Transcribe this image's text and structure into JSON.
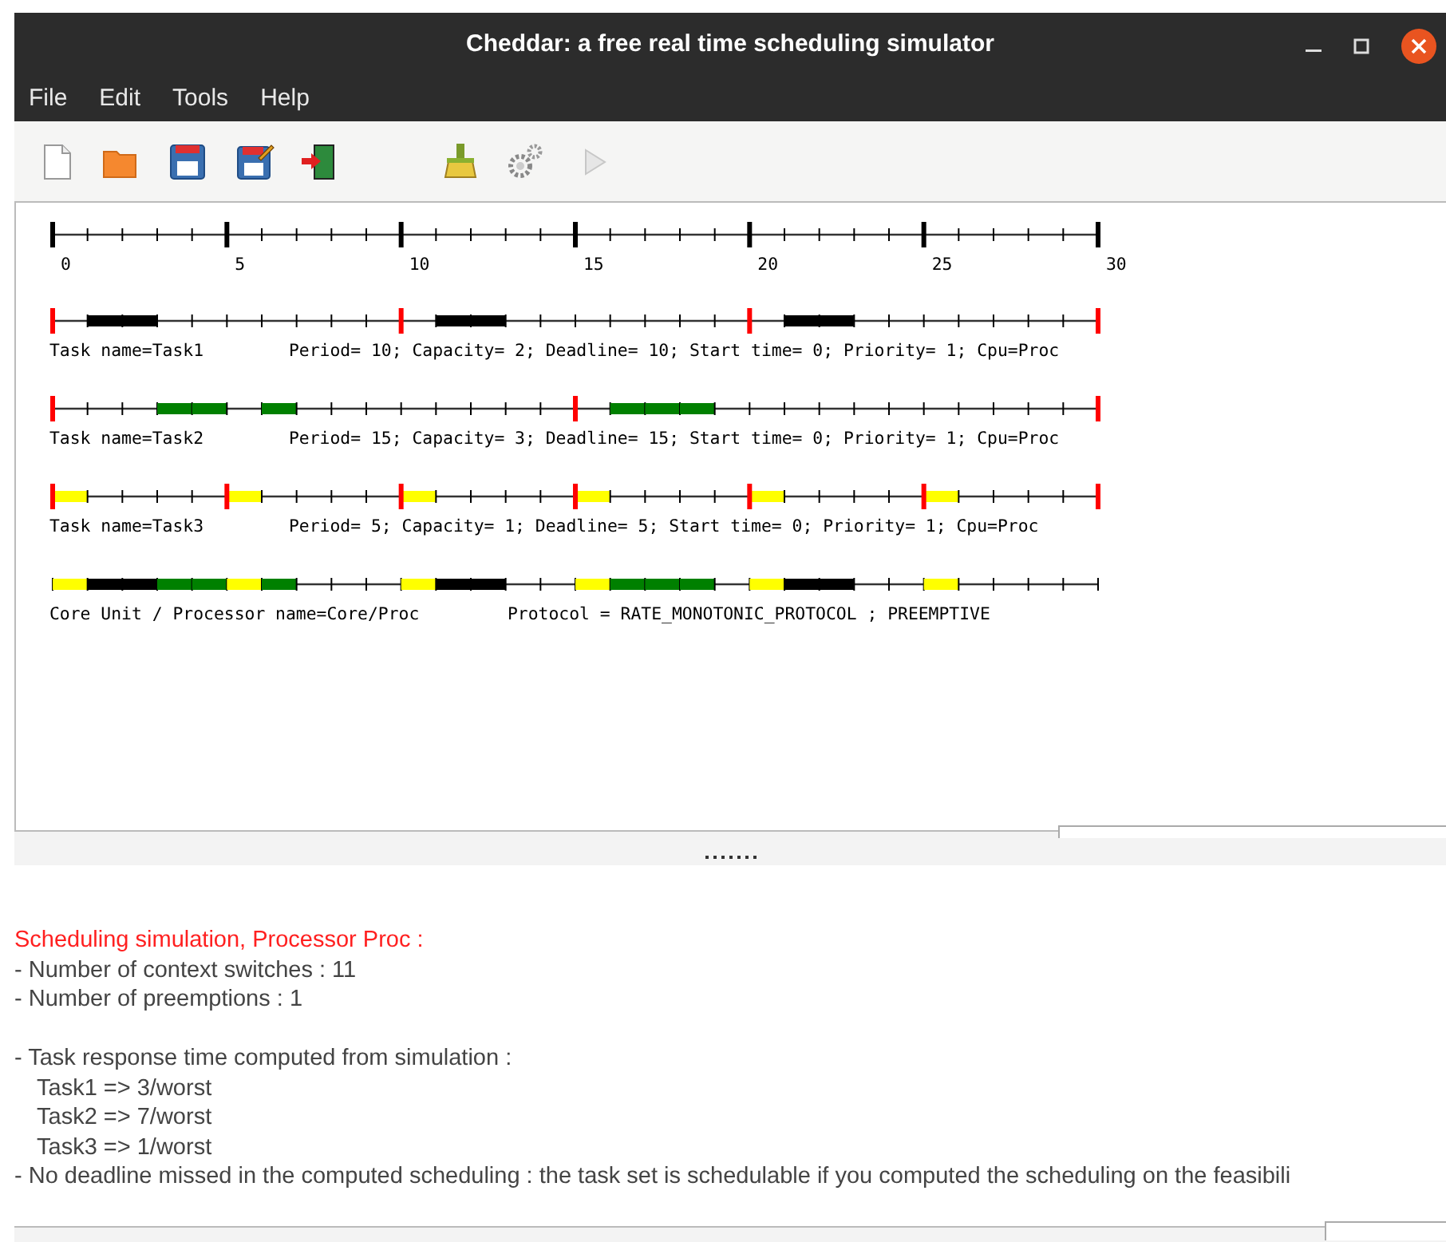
{
  "window": {
    "title": "Cheddar: a free real time scheduling simulator"
  },
  "menu": [
    "File",
    "Edit",
    "Tools",
    "Help"
  ],
  "toolbar": [
    {
      "kind": "new",
      "disabled": false
    },
    {
      "kind": "open",
      "disabled": false
    },
    {
      "kind": "save",
      "disabled": false
    },
    {
      "kind": "save_as",
      "disabled": false
    },
    {
      "kind": "exit",
      "disabled": false
    },
    {
      "kind": "clear",
      "disabled": false
    },
    {
      "kind": "settings",
      "disabled": false
    },
    {
      "kind": "run",
      "disabled": true
    }
  ],
  "time_axis": {
    "ticks": [
      "0",
      "5",
      "10",
      "15",
      "20",
      "25",
      "30"
    ]
  },
  "tasks": [
    {
      "name_label": "Task name=Task1",
      "parameters": "Period= 10; Capacity= 2; Deadline= 10; Start time= 0; Priority= 1; Cpu=Proc",
      "color": "#000000",
      "ticks": [
        {
          "release": true,
          "running": false
        },
        {
          "release": false,
          "running": true
        },
        {
          "release": false,
          "running": true
        },
        {
          "release": false,
          "running": false
        },
        {
          "release": false,
          "running": false
        },
        {
          "release": false,
          "running": false
        },
        {
          "release": false,
          "running": false
        },
        {
          "release": false,
          "running": false
        },
        {
          "release": false,
          "running": false
        },
        {
          "release": false,
          "running": false
        },
        {
          "release": true,
          "running": false
        },
        {
          "release": false,
          "running": true
        },
        {
          "release": false,
          "running": true
        },
        {
          "release": false,
          "running": false
        },
        {
          "release": false,
          "running": false
        },
        {
          "release": false,
          "running": false
        },
        {
          "release": false,
          "running": false
        },
        {
          "release": false,
          "running": false
        },
        {
          "release": false,
          "running": false
        },
        {
          "release": false,
          "running": false
        },
        {
          "release": true,
          "running": false
        },
        {
          "release": false,
          "running": true
        },
        {
          "release": false,
          "running": true
        },
        {
          "release": false,
          "running": false
        },
        {
          "release": false,
          "running": false
        },
        {
          "release": false,
          "running": false
        },
        {
          "release": false,
          "running": false
        },
        {
          "release": false,
          "running": false
        },
        {
          "release": false,
          "running": false
        },
        {
          "release": false,
          "running": false
        },
        {
          "release": true,
          "running": false
        }
      ]
    },
    {
      "name_label": "Task name=Task2",
      "parameters": "Period= 15; Capacity= 3; Deadline= 15; Start time= 0; Priority= 1; Cpu=Proc",
      "color": "#008000",
      "ticks": [
        {
          "release": true,
          "running": false
        },
        {
          "release": false,
          "running": false
        },
        {
          "release": false,
          "running": false
        },
        {
          "release": false,
          "running": true
        },
        {
          "release": false,
          "running": true
        },
        {
          "release": false,
          "running": false
        },
        {
          "release": false,
          "running": true
        },
        {
          "release": false,
          "running": false
        },
        {
          "release": false,
          "running": false
        },
        {
          "release": false,
          "running": false
        },
        {
          "release": false,
          "running": false
        },
        {
          "release": false,
          "running": false
        },
        {
          "release": false,
          "running": false
        },
        {
          "release": false,
          "running": false
        },
        {
          "release": false,
          "running": false
        },
        {
          "release": true,
          "running": false
        },
        {
          "release": false,
          "running": true
        },
        {
          "release": false,
          "running": true
        },
        {
          "release": false,
          "running": true
        },
        {
          "release": false,
          "running": false
        },
        {
          "release": false,
          "running": false
        },
        {
          "release": false,
          "running": false
        },
        {
          "release": false,
          "running": false
        },
        {
          "release": false,
          "running": false
        },
        {
          "release": false,
          "running": false
        },
        {
          "release": false,
          "running": false
        },
        {
          "release": false,
          "running": false
        },
        {
          "release": false,
          "running": false
        },
        {
          "release": false,
          "running": false
        },
        {
          "release": false,
          "running": false
        },
        {
          "release": true,
          "running": false
        }
      ]
    },
    {
      "name_label": "Task name=Task3",
      "parameters": "Period= 5; Capacity= 1; Deadline= 5; Start time= 0; Priority= 1; Cpu=Proc",
      "color": "#ffff00",
      "ticks": [
        {
          "release": true,
          "running": true
        },
        {
          "release": false,
          "running": false
        },
        {
          "release": false,
          "running": false
        },
        {
          "release": false,
          "running": false
        },
        {
          "release": false,
          "running": false
        },
        {
          "release": true,
          "running": true
        },
        {
          "release": false,
          "running": false
        },
        {
          "release": false,
          "running": false
        },
        {
          "release": false,
          "running": false
        },
        {
          "release": false,
          "running": false
        },
        {
          "release": true,
          "running": true
        },
        {
          "release": false,
          "running": false
        },
        {
          "release": false,
          "running": false
        },
        {
          "release": false,
          "running": false
        },
        {
          "release": false,
          "running": false
        },
        {
          "release": true,
          "running": true
        },
        {
          "release": false,
          "running": false
        },
        {
          "release": false,
          "running": false
        },
        {
          "release": false,
          "running": false
        },
        {
          "release": false,
          "running": false
        },
        {
          "release": true,
          "running": true
        },
        {
          "release": false,
          "running": false
        },
        {
          "release": false,
          "running": false
        },
        {
          "release": false,
          "running": false
        },
        {
          "release": false,
          "running": false
        },
        {
          "release": true,
          "running": true
        },
        {
          "release": false,
          "running": false
        },
        {
          "release": false,
          "running": false
        },
        {
          "release": false,
          "running": false
        },
        {
          "release": false,
          "running": false
        },
        {
          "release": true,
          "running": false
        }
      ]
    }
  ],
  "processor": {
    "label": "Core Unit / Processor name=Core/Proc",
    "protocol": "Protocol = RATE_MONOTONIC_PROTOCOL ; PREEMPTIVE",
    "ticks": [
      {
        "busy": true,
        "color": "#ffff00"
      },
      {
        "busy": true,
        "color": "#000000"
      },
      {
        "busy": true,
        "color": "#000000"
      },
      {
        "busy": true,
        "color": "#008000"
      },
      {
        "busy": true,
        "color": "#008000"
      },
      {
        "busy": true,
        "color": "#ffff00"
      },
      {
        "busy": true,
        "color": "#008000"
      },
      {
        "busy": false
      },
      {
        "busy": false
      },
      {
        "busy": false
      },
      {
        "busy": true,
        "color": "#ffff00"
      },
      {
        "busy": true,
        "color": "#000000"
      },
      {
        "busy": true,
        "color": "#000000"
      },
      {
        "busy": false
      },
      {
        "busy": false
      },
      {
        "busy": true,
        "color": "#ffff00"
      },
      {
        "busy": true,
        "color": "#008000"
      },
      {
        "busy": true,
        "color": "#008000"
      },
      {
        "busy": true,
        "color": "#008000"
      },
      {
        "busy": false
      },
      {
        "busy": true,
        "color": "#ffff00"
      },
      {
        "busy": true,
        "color": "#000000"
      },
      {
        "busy": true,
        "color": "#000000"
      },
      {
        "busy": false
      },
      {
        "busy": false
      },
      {
        "busy": true,
        "color": "#ffff00"
      },
      {
        "busy": false
      },
      {
        "busy": false
      },
      {
        "busy": false
      },
      {
        "busy": false
      }
    ]
  },
  "output": {
    "heading": "Scheduling simulation, Processor Proc :",
    "blocks": [
      {
        "lines": [
          {
            "text": "- Number of context switches :  11",
            "indented": false
          },
          {
            "text": "- Number of preemptions :  1",
            "indented": false
          }
        ]
      },
      {
        "lines": [
          {
            "text": "- Task response time computed from simulation :",
            "indented": false
          },
          {
            "text": "Task1 => 3/worst",
            "indented": true
          },
          {
            "text": "Task2 => 7/worst",
            "indented": true
          },
          {
            "text": "Task3 => 1/worst",
            "indented": true
          },
          {
            "text": "- No deadline missed in the computed scheduling : the task set is schedulable if you computed the scheduling on the feasibili",
            "indented": false
          }
        ]
      }
    ]
  }
}
